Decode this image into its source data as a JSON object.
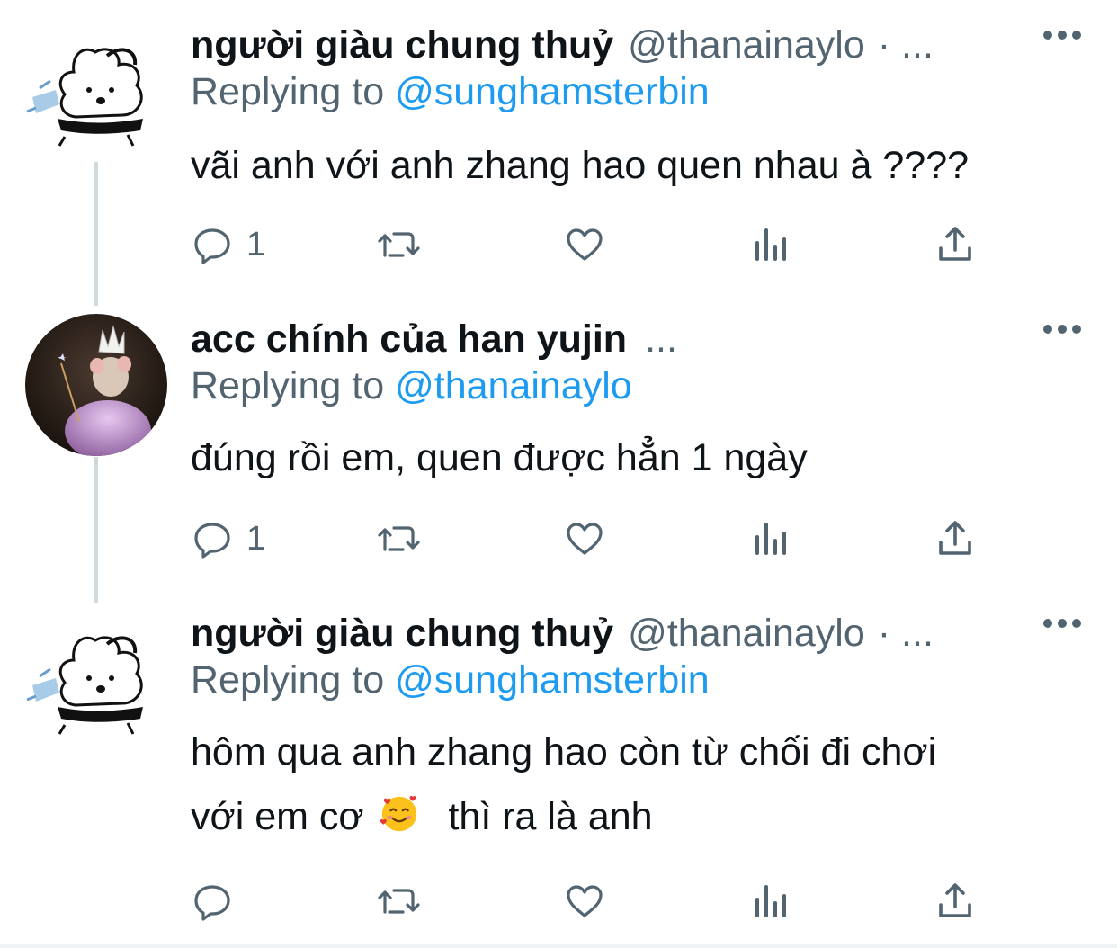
{
  "tweets": [
    {
      "name": "người giàu chung thuỷ",
      "handle": "@thanainaylo",
      "sep": "· ...",
      "replying_prefix": "Replying to",
      "replying_to": "@sunghamsterbin",
      "text": "vãi anh với anh zhang hao quen nhau à ????",
      "reply_count": "1",
      "avatar": "cartoon-doodle"
    },
    {
      "name": "acc chính của han yujin",
      "handle": "",
      "sep": "...",
      "replying_prefix": "Replying to",
      "replying_to": "@thanainaylo",
      "text": "đúng rồi em, quen được hẳn 1 ngày",
      "reply_count": "1",
      "avatar": "mouse-fairy-photo"
    },
    {
      "name": "người giàu chung thuỷ",
      "handle": "@thanainaylo",
      "sep": "· ...",
      "replying_prefix": "Replying to",
      "replying_to": "@sunghamsterbin",
      "text_line1": "hôm qua anh zhang hao còn từ chối đi chơi",
      "text_line2a": "với em cơ",
      "text_line2b": "thì ra là anh",
      "emoji": "smiling-face-with-hearts",
      "reply_count": "",
      "avatar": "cartoon-doodle"
    }
  ],
  "icons": [
    "reply-icon",
    "retweet-icon",
    "like-icon",
    "views-icon",
    "share-icon",
    "more-icon"
  ],
  "colors": {
    "link": "#1d9bf0",
    "secondary": "#536471",
    "text": "#0f1419",
    "thread": "#cfd9de"
  }
}
